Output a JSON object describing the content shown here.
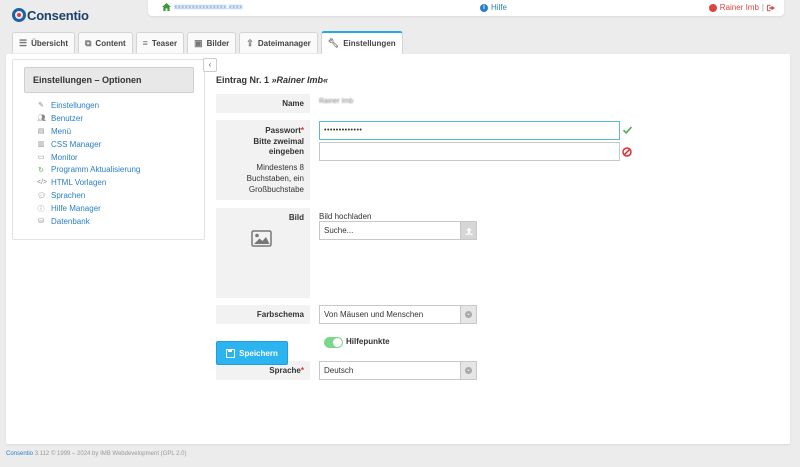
{
  "app": {
    "logo": "Consentio"
  },
  "topbar": {
    "site_link": "xxxxxxxxxxxxxxx.xxxx",
    "help": "Hilfe",
    "user": "Rainer Imb"
  },
  "tabs": [
    {
      "label": "Übersicht",
      "icon": "list-icon"
    },
    {
      "label": "Content",
      "icon": "copy-icon"
    },
    {
      "label": "Teaser",
      "icon": "teaser-icon"
    },
    {
      "label": "Bilder",
      "icon": "image-icon"
    },
    {
      "label": "Dateimanager",
      "icon": "upload-icon"
    },
    {
      "label": "Einstellungen",
      "icon": "wrench-icon",
      "active": true
    }
  ],
  "sidebar": {
    "title": "Einstellungen – Optionen",
    "items": [
      {
        "label": "Einstellungen",
        "icon": "wrench-icon"
      },
      {
        "label": "Benutzer",
        "icon": "users-icon"
      },
      {
        "label": "Menü",
        "icon": "menu-icon"
      },
      {
        "label": "CSS Manager",
        "icon": "css-icon"
      },
      {
        "label": "Monitor",
        "icon": "monitor-icon"
      },
      {
        "label": "Programm Aktualisierung",
        "icon": "refresh-icon"
      },
      {
        "label": "HTML Vorlagen",
        "icon": "code-icon"
      },
      {
        "label": "Sprachen",
        "icon": "comments-icon"
      },
      {
        "label": "Hilfe Manager",
        "icon": "info-icon"
      },
      {
        "label": "Datenbank",
        "icon": "database-icon"
      }
    ]
  },
  "entry": {
    "prefix": "Eintrag Nr. 1",
    "name": "»Rainer Imb«"
  },
  "form": {
    "name_label": "Name",
    "name_value": "Rainer Imb",
    "password_label": "Passwort",
    "password_sub": "Bitte zweimal eingeben",
    "password_hint": "Mindestens 8 Buchstaben, ein Großbuchstabe",
    "password_value": "•••••••••••••",
    "password_repeat_value": "",
    "image_label": "Bild",
    "image_upload_label": "Bild hochladen",
    "image_search_label": "Suche...",
    "scheme_label": "Farbschema",
    "scheme_value": "Von Mäusen und Menschen",
    "help_points_label": "Hilfepunkte",
    "help_points_on": true,
    "language_label": "Sprache",
    "language_value": "Deutsch",
    "save_label": "Speichern"
  },
  "footer": {
    "brand": "Consentio",
    "text": "3.112 © 1999 – 2024 by IMB Webdevelopment (GPL 2.0)"
  },
  "colors": {
    "accent": "#2bb4ef",
    "link": "#2a7fc9",
    "required": "#d93030",
    "ok": "#4caf50",
    "error": "#d93030"
  }
}
